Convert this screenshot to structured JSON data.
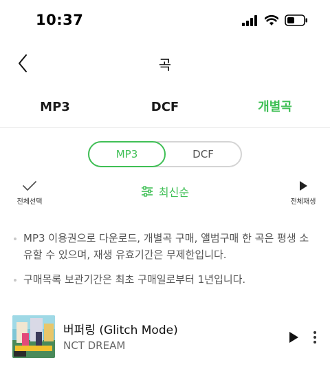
{
  "status_bar": {
    "time": "10:37"
  },
  "header": {
    "back_icon": "chevron-left-icon",
    "title": "곡"
  },
  "tabs": [
    {
      "label": "MP3",
      "active": false
    },
    {
      "label": "DCF",
      "active": false
    },
    {
      "label": "개별곡",
      "active": true
    }
  ],
  "segment": {
    "options": [
      "MP3",
      "DCF"
    ],
    "selected": "MP3"
  },
  "toolbar": {
    "select_all_label": "전체선택",
    "select_all_icon": "checkmark-icon",
    "sort_label": "최신순",
    "sort_icon": "sliders-icon",
    "play_all_label": "전체재생",
    "play_all_icon": "play-icon"
  },
  "notes": [
    "MP3 이용권으로 다운로드, 개별곡 구매, 앨범구매 한 곡은 평생 소유할 수 있으며, 재생 유효기간은 무제한입니다.",
    "구매목록 보관기간은 최초 구매일로부터 1년입니다."
  ],
  "tracks": [
    {
      "title": "버퍼링 (Glitch Mode)",
      "artist": "NCT DREAM"
    }
  ],
  "colors": {
    "accent": "#3fbf55",
    "text": "#111111",
    "muted": "#555555"
  }
}
